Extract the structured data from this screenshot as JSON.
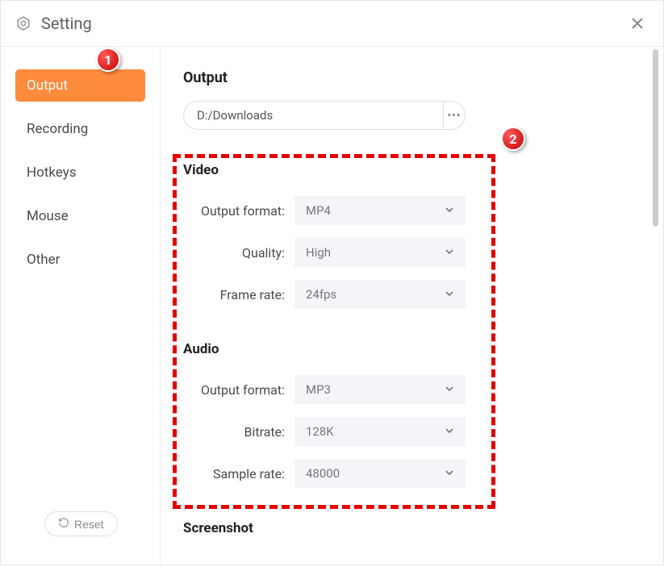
{
  "window": {
    "title": "Setting"
  },
  "sidebar": {
    "items": [
      {
        "label": "Output",
        "active": true
      },
      {
        "label": "Recording",
        "active": false
      },
      {
        "label": "Hotkeys",
        "active": false
      },
      {
        "label": "Mouse",
        "active": false
      },
      {
        "label": "Other",
        "active": false
      }
    ],
    "reset_label": "Reset"
  },
  "main": {
    "output": {
      "title": "Output",
      "path": "D:/Downloads"
    },
    "video": {
      "title": "Video",
      "output_format_label": "Output format:",
      "output_format_value": "MP4",
      "quality_label": "Quality:",
      "quality_value": "High",
      "framerate_label": "Frame rate:",
      "framerate_value": "24fps"
    },
    "audio": {
      "title": "Audio",
      "output_format_label": "Output format:",
      "output_format_value": "MP3",
      "bitrate_label": "Bitrate:",
      "bitrate_value": "128K",
      "samplerate_label": "Sample rate:",
      "samplerate_value": "48000"
    },
    "screenshot": {
      "title": "Screenshot"
    }
  },
  "annotations": {
    "badge1": "1",
    "badge2": "2"
  }
}
